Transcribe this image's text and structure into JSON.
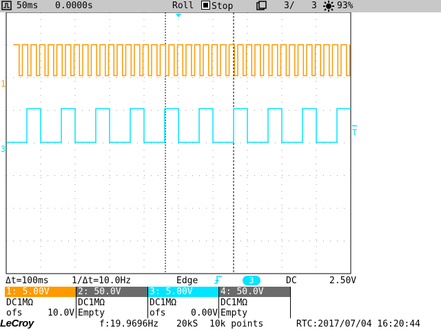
{
  "topbar": {
    "timebase": "50ms",
    "delay": "0.0000s",
    "mode": "Roll",
    "run_state": "Stop",
    "acq_count": "3/",
    "acq_total": "3",
    "battery": "93%",
    "icons": [
      "save-icon",
      "battery-icon"
    ]
  },
  "channels": {
    "ch1": {
      "marker": "1",
      "color": "#ff9900"
    },
    "ch3": {
      "marker": "3",
      "color": "#00e5ff"
    },
    "trigger_level_marker": "T"
  },
  "measure": {
    "delta_t": "Δt=100ms",
    "inv_delta_t": "1/Δt=10.0Hz",
    "trigger_type": "Edge",
    "trigger_source": "3",
    "coupling": "DC",
    "trigger_level": "2.50V"
  },
  "channel_boxes": [
    {
      "header": "1: 5.00V",
      "coupling": "DC1MΩ",
      "ofs_label": "ofs",
      "ofs_value": "10.0V",
      "header_bg": "#ff9900",
      "header_fg": "#ffffff"
    },
    {
      "header": "2: 50.0V",
      "coupling": "DC1MΩ",
      "ofs_label": "Empty",
      "ofs_value": "",
      "header_bg": "#6b6b6b",
      "header_fg": "#ffffff"
    },
    {
      "header": "3: 5.00V",
      "coupling": "DC1MΩ",
      "ofs_label": "ofs",
      "ofs_value": "0.00V",
      "header_bg": "#00e5ff",
      "header_fg": "#ffffff"
    },
    {
      "header": "4: 50.0V",
      "coupling": "DC1MΩ",
      "ofs_label": "Empty",
      "ofs_value": "",
      "header_bg": "#6b6b6b",
      "header_fg": "#ffffff"
    }
  ],
  "bottom": {
    "brand": "LeCroy",
    "frequency": "f:19.9696Hz",
    "sample_rate": "20kS",
    "points": "10k points",
    "rtc": "RTC:2017/07/04 16:20:44"
  }
}
